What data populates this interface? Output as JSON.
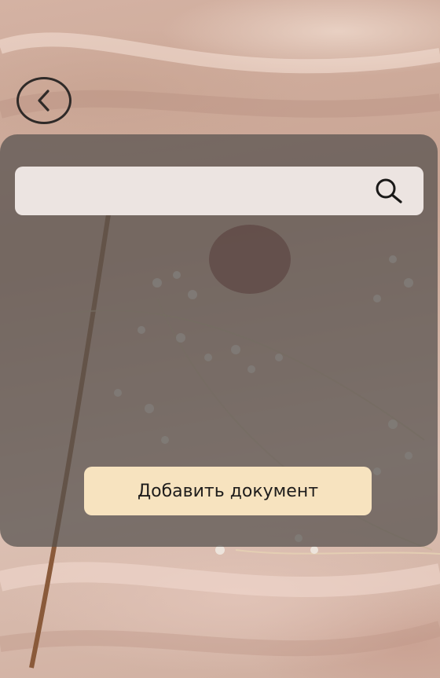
{
  "back": {
    "icon": "chevron-left-icon"
  },
  "search": {
    "value": "",
    "placeholder": "",
    "icon": "search-icon"
  },
  "actions": {
    "add_document_label": "Добавить документ"
  },
  "colors": {
    "panel_overlay": "#55504e",
    "search_field": "#ece4e1",
    "add_button": "#f7e3bf",
    "icon_stroke": "#2f2a28"
  }
}
